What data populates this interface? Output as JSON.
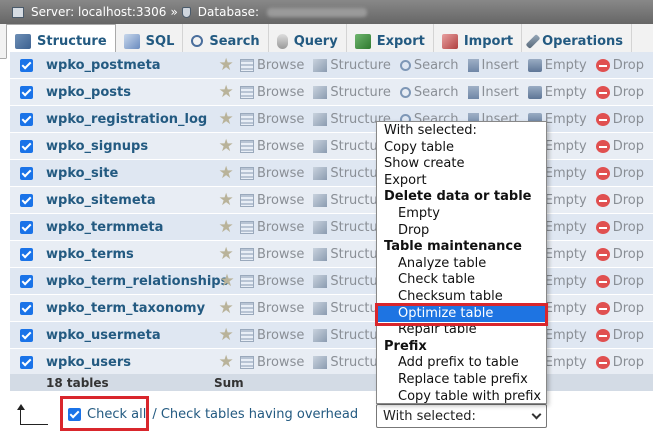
{
  "breadcrumb": {
    "server": "Server: localhost:3306",
    "sep": "»",
    "database": "Database:"
  },
  "tabs": [
    {
      "label": "Structure",
      "icon": "structure-icon"
    },
    {
      "label": "SQL",
      "icon": "sql-icon"
    },
    {
      "label": "Search",
      "icon": "search-icon"
    },
    {
      "label": "Query",
      "icon": "query-icon"
    },
    {
      "label": "Export",
      "icon": "export-icon"
    },
    {
      "label": "Import",
      "icon": "import-icon"
    },
    {
      "label": "Operations",
      "icon": "wrench-icon"
    }
  ],
  "actions": {
    "browse": "Browse",
    "structure": "Structure",
    "search": "Search",
    "insert": "Insert",
    "empty": "Empty",
    "drop": "Drop"
  },
  "tables": [
    "wpko_postmeta",
    "wpko_posts",
    "wpko_registration_log",
    "wpko_signups",
    "wpko_site",
    "wpko_sitemeta",
    "wpko_termmeta",
    "wpko_terms",
    "wpko_term_relationships",
    "wpko_term_taxonomy",
    "wpko_usermeta",
    "wpko_users"
  ],
  "summary": {
    "count": "18 tables",
    "sum": "Sum"
  },
  "bottom": {
    "check_all": "Check all",
    "check_overhead": "/ Check tables having overhead",
    "select_value": "With selected:"
  },
  "dropdown": [
    {
      "label": "With selected:",
      "kind": "opt"
    },
    {
      "label": "Copy table",
      "kind": "opt"
    },
    {
      "label": "Show create",
      "kind": "opt"
    },
    {
      "label": "Export",
      "kind": "opt"
    },
    {
      "label": "Delete data or table",
      "kind": "grp"
    },
    {
      "label": "Empty",
      "kind": "sub"
    },
    {
      "label": "Drop",
      "kind": "sub"
    },
    {
      "label": "Table maintenance",
      "kind": "grp"
    },
    {
      "label": "Analyze table",
      "kind": "sub"
    },
    {
      "label": "Check table",
      "kind": "sub"
    },
    {
      "label": "Checksum table",
      "kind": "sub"
    },
    {
      "label": "Optimize table",
      "kind": "sub",
      "selected": true
    },
    {
      "label": "Repair table",
      "kind": "sub"
    },
    {
      "label": "Prefix",
      "kind": "grp"
    },
    {
      "label": "Add prefix to table",
      "kind": "sub"
    },
    {
      "label": "Replace table prefix",
      "kind": "sub"
    },
    {
      "label": "Copy table with prefix",
      "kind": "sub"
    }
  ],
  "colors": {
    "accent": "#1e74e2",
    "highlight": "#d9262c",
    "link": "#235a81"
  }
}
